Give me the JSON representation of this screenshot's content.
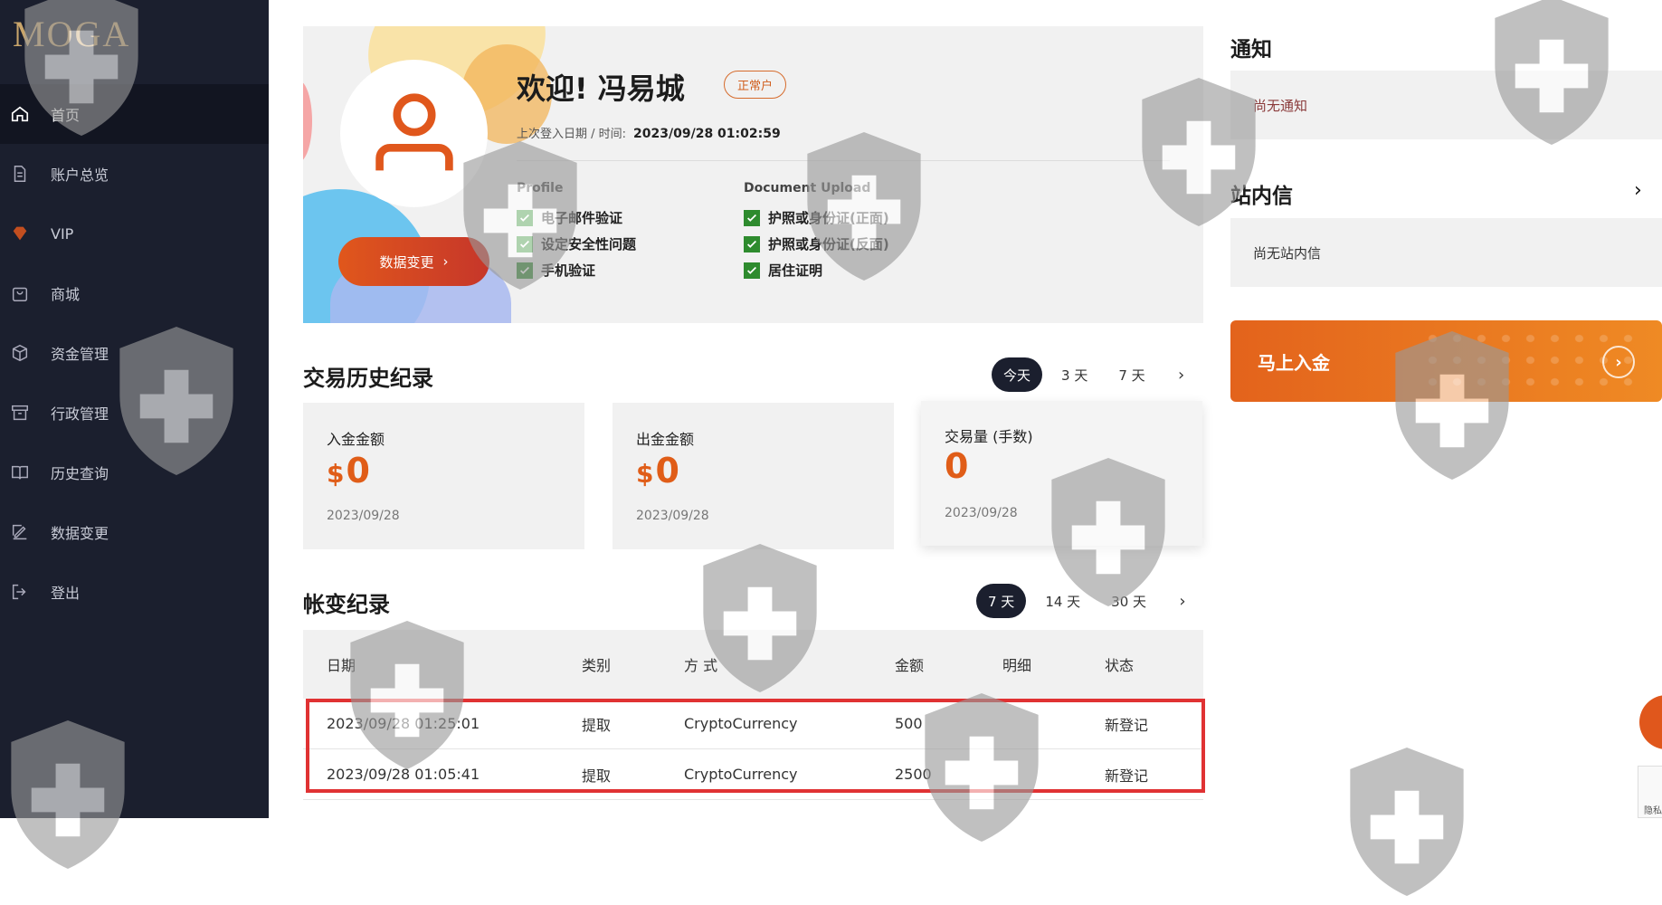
{
  "brand": {
    "logo_text": "MOGA"
  },
  "sidebar": {
    "items": [
      {
        "label": "首页",
        "icon": "home-icon"
      },
      {
        "label": "账户总览",
        "icon": "document-icon"
      },
      {
        "label": "VIP",
        "icon": "diamond-icon"
      },
      {
        "label": "商城",
        "icon": "shopping-bag-icon"
      },
      {
        "label": "资金管理",
        "icon": "box-icon"
      },
      {
        "label": "行政管理",
        "icon": "archive-icon"
      },
      {
        "label": "历史查询",
        "icon": "book-icon"
      },
      {
        "label": "数据变更",
        "icon": "edit-icon"
      },
      {
        "label": "登出",
        "icon": "logout-icon"
      }
    ]
  },
  "profile": {
    "welcome": "欢迎! 冯易城",
    "badge": "正常户",
    "last_login_label": "上次登入日期 / 时间:",
    "last_login_value": "2023/09/28 01:02:59",
    "edit_button": "数据变更",
    "profile_head": "Profile",
    "profile_checks": [
      "电子邮件验证",
      "设定安全性问题",
      "手机验证"
    ],
    "document_head": "Document Upload",
    "document_checks": [
      "护照或身份证(正面)",
      "护照或身份证(反面)",
      "居住证明"
    ]
  },
  "trade_history": {
    "title": "交易历史纪录",
    "filters": [
      "今天",
      "3 天",
      "7 天"
    ],
    "stats": [
      {
        "label": "入金金额",
        "currency": "$",
        "value": "0",
        "date": "2023/09/28"
      },
      {
        "label": "出金金额",
        "currency": "$",
        "value": "0",
        "date": "2023/09/28"
      },
      {
        "label": "交易量 (手数)",
        "currency": "",
        "value": "0",
        "date": "2023/09/28"
      }
    ]
  },
  "account_changes": {
    "title": "帐变纪录",
    "filters": [
      "7 天",
      "14 天",
      "30 天"
    ],
    "columns": [
      "日期",
      "类别",
      "方 式",
      "金额",
      "明细",
      "状态"
    ],
    "rows": [
      [
        "2023/09/28 01:25:01",
        "提取",
        "CryptoCurrency",
        "500",
        "",
        "新登记"
      ],
      [
        "2023/09/28 01:05:41",
        "提取",
        "CryptoCurrency",
        "2500",
        "",
        "新登记"
      ]
    ]
  },
  "notices": {
    "title": "通知",
    "empty": "尚无通知"
  },
  "inbox": {
    "title": "站内信",
    "empty": "尚无站内信"
  },
  "deposit": {
    "label": "马上入金"
  },
  "recaptcha": {
    "text": "隐私"
  },
  "colors": {
    "accent": "#e05d18",
    "sidebar": "#1b1f2e",
    "highlight": "#e03233",
    "check": "#2e8b2e"
  }
}
